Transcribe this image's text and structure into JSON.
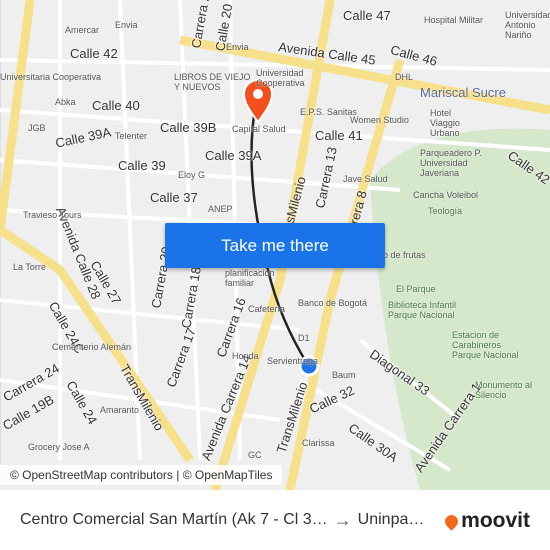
{
  "map": {
    "streets": [
      "Calle 47",
      "Avenida Calle 45",
      "Calle 46",
      "Calle 42",
      "Calle 40",
      "Calle 39A",
      "Calle 39B",
      "Calle 39",
      "Calle 39A",
      "Calle 41",
      "Calle 37",
      "Calle 42",
      "Avenida Calle 28",
      "Calle 27",
      "Calle 24C",
      "Calle 24",
      "Calle 19B",
      "Carrera 24",
      "Carrera 20",
      "Carrera 18",
      "Carrera 17",
      "Carrera 16",
      "Carrera 13",
      "Carrera 8",
      "Avenida Carrera 14",
      "TransMilenio",
      "TransMilenio",
      "TransMilenio",
      "Calle 32",
      "Calle 30A",
      "Diagonal 33",
      "Avenida Carrera 1",
      "Carrera 20",
      "Calle 20"
    ],
    "pois": [
      "Hospital Militar",
      "Universidad Antonio Nariño",
      "Mariscal Sucre",
      "DHL",
      "Envia",
      "Envia",
      "Amercar",
      "LIBROS DE VIEJO Y NUEVOS",
      "Universidad Cooperativa",
      "E.P.S. Sanitas",
      "Capital Salud",
      "Women Studio",
      "Hotel Viaggio Urbano",
      "Parqueadero P. Universidad Javeriana",
      "Jave Salud",
      "Cancha Voleibol",
      "Teología",
      "Eloy G",
      "ANEP",
      "Travieso Tours",
      "La Torre",
      "Abka",
      "Telenter",
      "JGB",
      "Universitaria Cooperativa",
      "planificación familiar",
      "Banco de Bogotá",
      "Cafetería",
      "D1",
      "Honda",
      "Servientrega",
      "Baum",
      "Clarissa",
      "Cementerio Alemán",
      "Amaranto",
      "Grocery Jose A",
      "El Parque",
      "Biblioteca Infantil Parque Nacional",
      "Estacion de Carabineros Parque Nacional",
      "Monumento al Silencio",
      "Puesto de frutas",
      "GC"
    ],
    "origin_color": "#1a73e8",
    "destination_color": "#f24e1e"
  },
  "cta": {
    "label": "Take me there"
  },
  "attribution": "© OpenStreetMap contributors | © OpenMapTiles",
  "footer": {
    "origin": "Centro Comercial San Martín (Ak 7 - Cl 3…",
    "arrow": "→",
    "destination": "Uninpa…",
    "brand": "moovit"
  }
}
